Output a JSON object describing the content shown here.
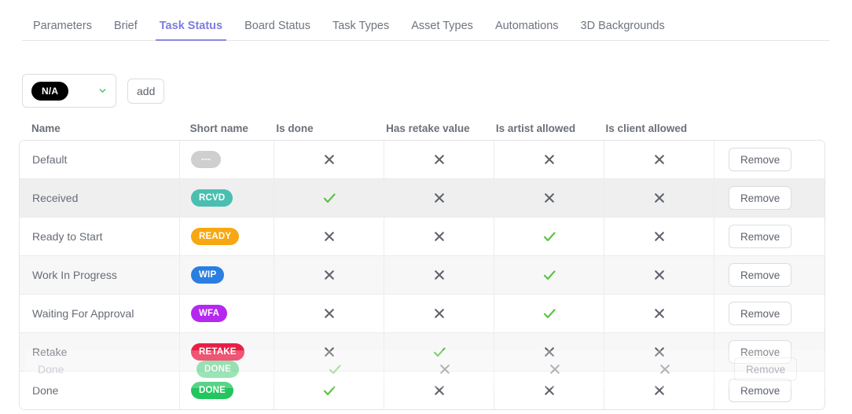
{
  "tabs": [
    {
      "label": "Parameters",
      "active": false
    },
    {
      "label": "Brief",
      "active": false
    },
    {
      "label": "Task Status",
      "active": true
    },
    {
      "label": "Board Status",
      "active": false
    },
    {
      "label": "Task Types",
      "active": false
    },
    {
      "label": "Asset Types",
      "active": false
    },
    {
      "label": "Automations",
      "active": false
    },
    {
      "label": "3D Backgrounds",
      "active": false
    }
  ],
  "toolbar": {
    "selected_status": "N/A",
    "selected_status_color": "#000000",
    "chevron_icon": "chevron-down-icon",
    "chevron_color": "#3fbf6b",
    "add_label": "add"
  },
  "table": {
    "columns": [
      "Name",
      "Short name",
      "Is done",
      "Has retake value",
      "Is artist allowed",
      "Is client allowed",
      ""
    ],
    "remove_label": "Remove",
    "check_color": "#5cc347",
    "cross_color": "#5f636b",
    "rows": [
      {
        "name": "Default",
        "short_name": "---",
        "short_color": "#cfcfcf",
        "is_done": false,
        "has_retake_value": false,
        "is_artist_allowed": false,
        "is_client_allowed": false,
        "remove": "Remove"
      },
      {
        "name": "Received",
        "short_name": "RCVD",
        "short_color": "#4abfb0",
        "is_done": true,
        "has_retake_value": false,
        "is_artist_allowed": false,
        "is_client_allowed": false,
        "remove": "Remove"
      },
      {
        "name": "Ready to Start",
        "short_name": "READY",
        "short_color": "#f7a711",
        "is_done": false,
        "has_retake_value": false,
        "is_artist_allowed": true,
        "is_client_allowed": false,
        "remove": "Remove"
      },
      {
        "name": "Work In Progress",
        "short_name": "WIP",
        "short_color": "#2a7fe0",
        "is_done": false,
        "has_retake_value": false,
        "is_artist_allowed": true,
        "is_client_allowed": false,
        "remove": "Remove"
      },
      {
        "name": "Waiting For Approval",
        "short_name": "WFA",
        "short_color": "#b528f0",
        "is_done": false,
        "has_retake_value": false,
        "is_artist_allowed": true,
        "is_client_allowed": false,
        "remove": "Remove"
      },
      {
        "name": "Retake",
        "short_name": "RETAKE",
        "short_color": "#e81f45",
        "is_done": false,
        "has_retake_value": true,
        "is_artist_allowed": false,
        "is_client_allowed": false,
        "remove": "Remove"
      },
      {
        "name": "Done",
        "short_name": "DONE",
        "short_color": "#22c55e",
        "is_done": true,
        "has_retake_value": false,
        "is_artist_allowed": false,
        "is_client_allowed": false,
        "remove": "Remove"
      }
    ],
    "dragged_row": {
      "name": "Done",
      "short_name": "DONE",
      "short_color": "#22c55e",
      "is_done": true,
      "has_retake_value": false,
      "is_artist_allowed": false,
      "is_client_allowed": false,
      "remove": "Remove"
    }
  }
}
